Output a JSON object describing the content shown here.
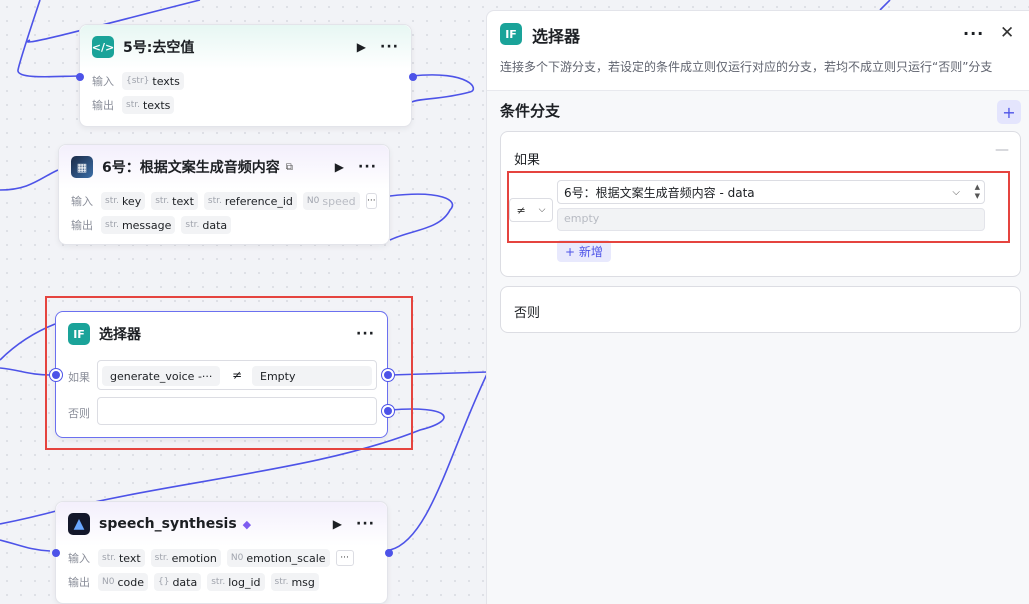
{
  "colors": {
    "accent": "#4d53e8",
    "highlight": "#e5443f",
    "teal": "#1aa399"
  },
  "nodes": {
    "node5": {
      "title": "5号:去空值",
      "icon": "code-icon",
      "input_label": "输入",
      "output_label": "输出",
      "inputs": [
        {
          "type": "{str}",
          "name": "texts"
        }
      ],
      "outputs": [
        {
          "type": "str.",
          "name": "texts"
        }
      ]
    },
    "node6": {
      "title": "6号：根据文案生成音频内容",
      "icon": "image-icon",
      "input_label": "输入",
      "output_label": "输出",
      "inputs": [
        {
          "type": "str.",
          "name": "key"
        },
        {
          "type": "str.",
          "name": "text"
        },
        {
          "type": "str.",
          "name": "reference_id"
        },
        {
          "type": "N0",
          "name": "speed"
        }
      ],
      "outputs": [
        {
          "type": "str.",
          "name": "message"
        },
        {
          "type": "str.",
          "name": "data"
        }
      ]
    },
    "selector": {
      "title": "选择器",
      "icon_text": "IF",
      "if_label": "如果",
      "else_label": "否则",
      "condition_left": "generate_voice",
      "condition_left_more": "-···",
      "operator": "≠",
      "condition_right": "Empty"
    },
    "speech": {
      "title": "speech_synthesis",
      "input_label": "输入",
      "output_label": "输出",
      "inputs": [
        {
          "type": "str.",
          "name": "text"
        },
        {
          "type": "str.",
          "name": "emotion"
        },
        {
          "type": "N0",
          "name": "emotion_scale"
        }
      ],
      "outputs": [
        {
          "type": "N0",
          "name": "code"
        },
        {
          "type": "{}",
          "name": "data"
        },
        {
          "type": "str.",
          "name": "log_id"
        },
        {
          "type": "str.",
          "name": "msg"
        }
      ]
    }
  },
  "panel": {
    "icon_text": "IF",
    "title": "选择器",
    "description": "连接多个下游分支，若设定的条件成立则仅运行对应的分支，若均不成立则只运行“否则”分支",
    "section_title": "条件分支",
    "if_label": "如果",
    "operator": "≠",
    "variable": "6号：根据文案生成音频内容 - data",
    "value_placeholder": "empty",
    "add_condition_label": "+ 新增",
    "else_label": "否则"
  }
}
